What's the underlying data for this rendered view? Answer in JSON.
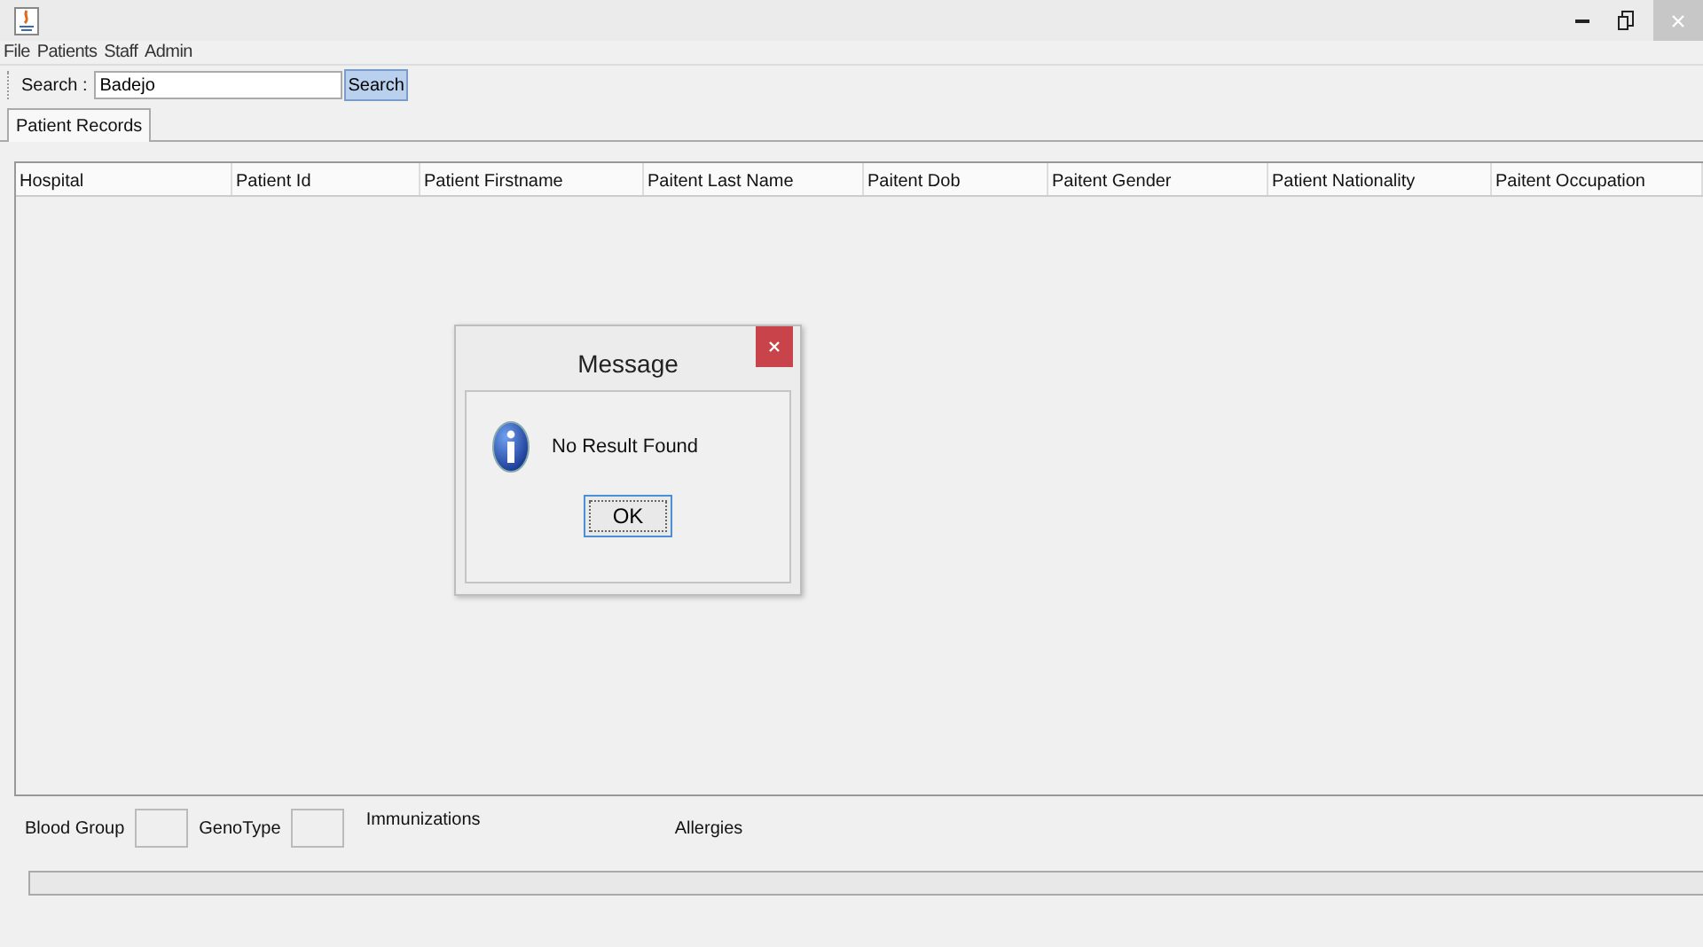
{
  "menu": [
    "File",
    "Patients",
    "Staff",
    "Admin"
  ],
  "search": {
    "label": "Search :",
    "value": "Badejo",
    "button": "Search"
  },
  "tabs": [
    {
      "label": "Patient Records",
      "selected": true
    }
  ],
  "table": {
    "columns": [
      "Hospital",
      "Patient Id",
      "Patient Firstname",
      "Paitent Last Name",
      "Paitent Dob",
      "Paitent Gender",
      "Patient Nationality",
      "Paitent Occupation"
    ]
  },
  "bottom": {
    "blood_group_label": "Blood Group",
    "genotype_label": "GenoType",
    "immunizations_label": "Immunizations",
    "allergies_label": "Allergies"
  },
  "dialog": {
    "title": "Message",
    "message": "No Result Found",
    "button": "OK"
  }
}
